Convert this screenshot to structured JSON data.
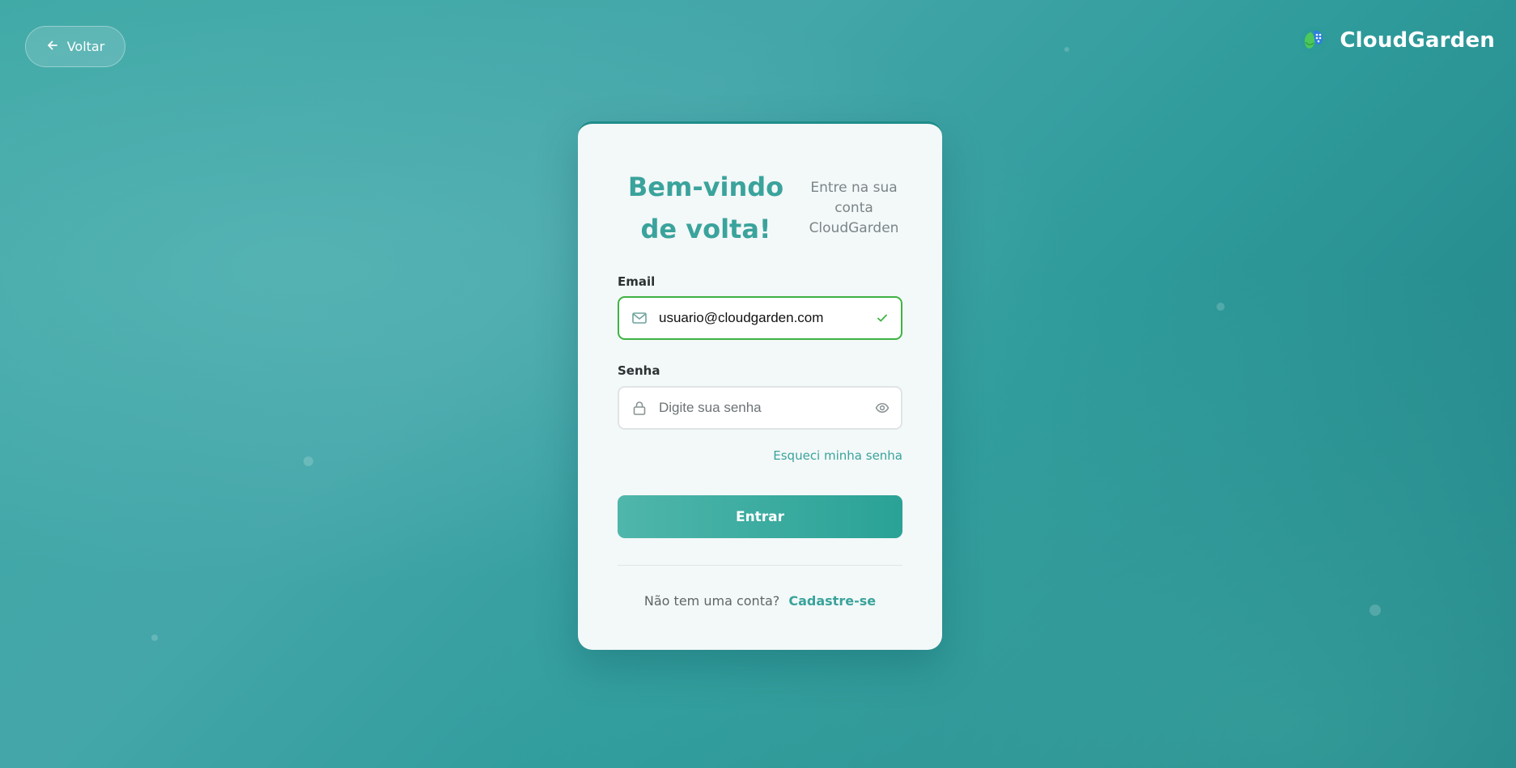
{
  "nav": {
    "back_label": "Voltar",
    "back_icon": "arrow-left-icon"
  },
  "brand": {
    "name": "CloudGarden",
    "logo_icon": "cloudgarden-logo-icon"
  },
  "login": {
    "title": "Bem-vindo de volta!",
    "subtitle": "Entre na sua conta CloudGarden",
    "email": {
      "label": "Email",
      "value": "usuario@cloudgarden.com",
      "icon": "mail-icon",
      "status_icon": "check-icon"
    },
    "password": {
      "label": "Senha",
      "value": "",
      "placeholder": "Digite sua senha",
      "icon": "lock-icon",
      "toggle_icon": "eye-icon"
    },
    "forgot_label": "Esqueci minha senha",
    "submit_label": "Entrar",
    "signup_prompt": "Não tem uma conta?",
    "signup_link": "Cadastre-se"
  },
  "colors": {
    "accent": "#3aa39c",
    "valid_border": "#3db343",
    "button_start": "#4fb6ab",
    "button_end": "#2aa296"
  }
}
